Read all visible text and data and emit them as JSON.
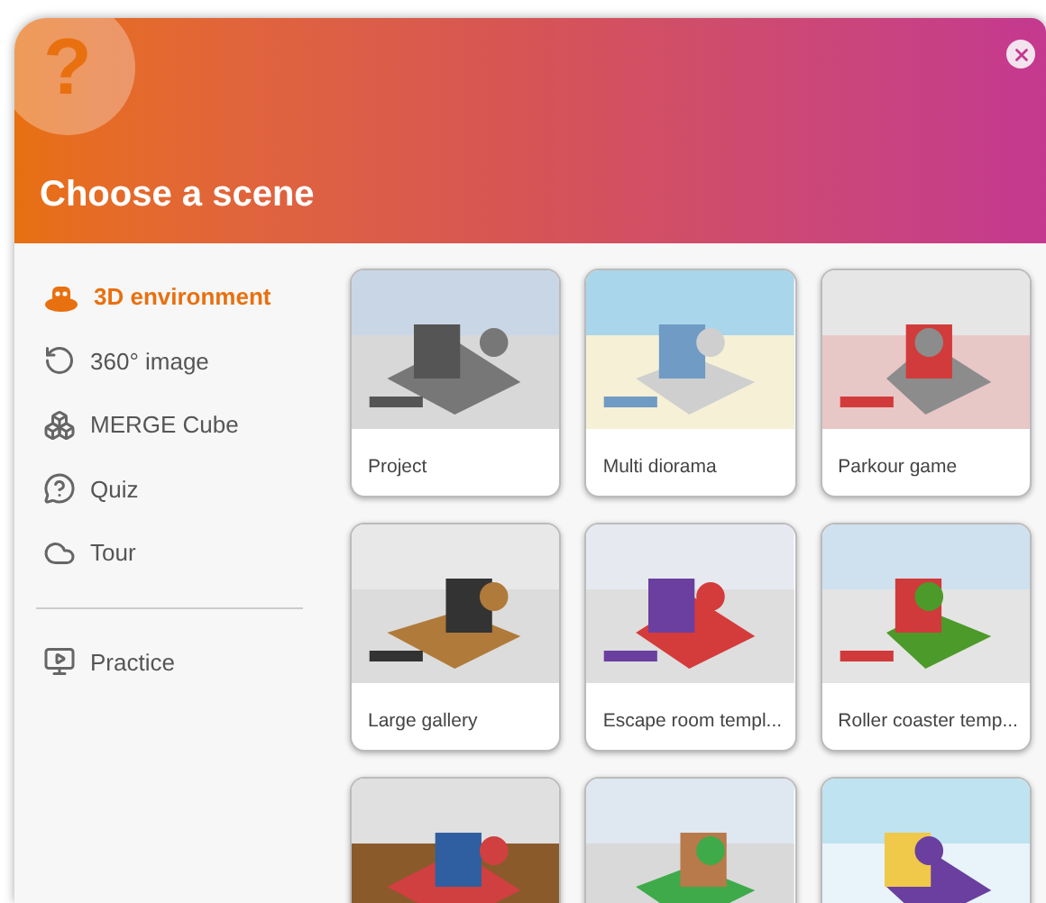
{
  "dialog": {
    "title": "Choose a scene",
    "help_mark": "?"
  },
  "sidebar": {
    "items": [
      {
        "label": "3D environment",
        "kind": "environment",
        "selected": true
      },
      {
        "label": "360° image",
        "kind": "rotate",
        "selected": false
      },
      {
        "label": "MERGE Cube",
        "kind": "cube",
        "selected": false
      },
      {
        "label": "Quiz",
        "kind": "quiz",
        "selected": false
      },
      {
        "label": "Tour",
        "kind": "tour",
        "selected": false
      }
    ],
    "footer_items": [
      {
        "label": "Practice",
        "kind": "practice",
        "selected": false
      }
    ]
  },
  "scenes": [
    {
      "title": "Project",
      "kind": "picture"
    },
    {
      "title": "Multi diorama",
      "kind": "picture"
    },
    {
      "title": "Parkour game",
      "kind": "picture"
    },
    {
      "title": "Large gallery",
      "kind": "picture"
    },
    {
      "title": "Escape room templ...",
      "kind": "picture"
    },
    {
      "title": "Roller coaster temp...",
      "kind": "picture"
    },
    {
      "kind": "picture"
    },
    {
      "kind": "picture"
    },
    {
      "kind": "picture"
    }
  ]
}
